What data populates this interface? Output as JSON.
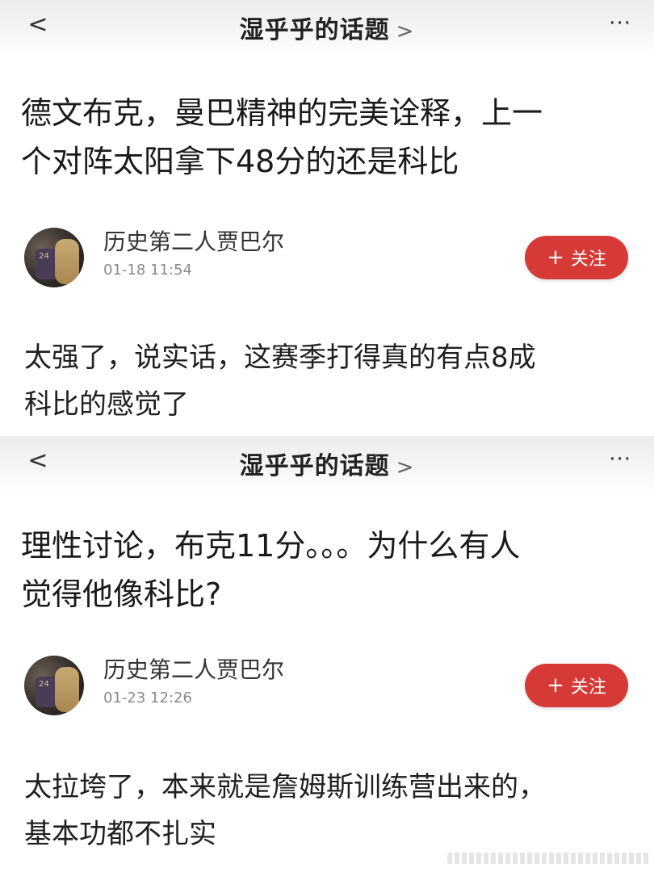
{
  "screens": [
    {
      "nav": {
        "back": "<",
        "title": "湿乎乎的话题",
        "chevron": ">",
        "more": "···"
      },
      "post_title_line1": "德文布克，曼巴精神的完美诠释，上一",
      "post_title_line2": "个对阵太阳拿下48分的还是科比",
      "author": {
        "name": "历史第二人贾巴尔",
        "time": "01-18 11:54",
        "avatar_icon": "avatar-player-photo"
      },
      "follow": {
        "plus": "+",
        "label": "关注"
      },
      "comment_line1": "太强了，说实话，这赛季打得真的有点8成",
      "comment_line2": "科比的感觉了"
    },
    {
      "nav": {
        "back": "<",
        "title": "湿乎乎的话题",
        "chevron": ">",
        "more": "···"
      },
      "post_title_line1": "理性讨论，布克11分。。。为什么有人",
      "post_title_line2": "觉得他像科比?",
      "author": {
        "name": "历史第二人贾巴尔",
        "time": "01-23 12:26",
        "avatar_icon": "avatar-player-photo"
      },
      "follow": {
        "plus": "+",
        "label": "关注"
      },
      "comment_line1": "太拉垮了，本来就是詹姆斯训练营出来的，",
      "comment_line2": "基本功都不扎实"
    }
  ],
  "colors": {
    "follow_button": "#d53a36",
    "title_text": "#1a1a1a",
    "time_text": "#8a8a8a"
  }
}
